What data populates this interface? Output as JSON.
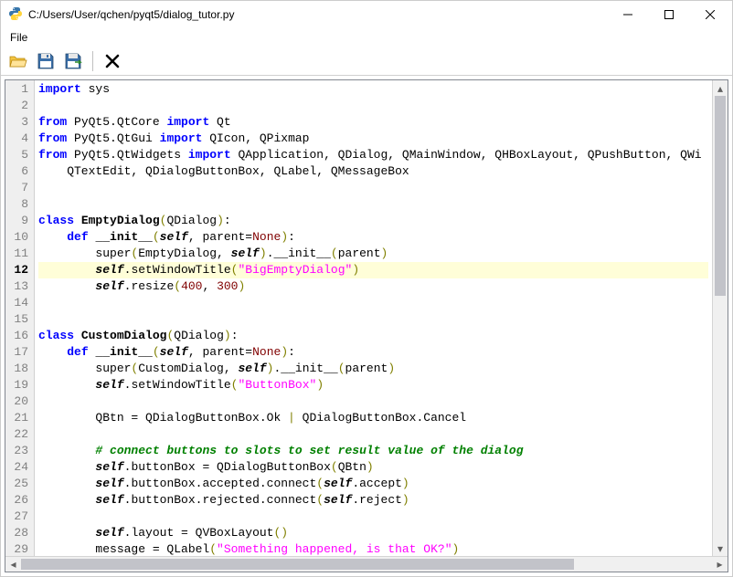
{
  "window": {
    "title": "C:/Users/User/qchen/pyqt5/dialog_tutor.py"
  },
  "menubar": {
    "file": "File"
  },
  "toolbar": {
    "open": "open-folder-icon",
    "save": "save-icon",
    "saveas": "save-as-icon",
    "clear": "clear-icon"
  },
  "editor": {
    "current_line": 12,
    "lines": [
      {
        "n": 1,
        "html": "<span class='kw'>import</span> sys"
      },
      {
        "n": 2,
        "html": ""
      },
      {
        "n": 3,
        "html": "<span class='kw'>from</span> PyQt5.QtCore <span class='kw'>import</span> Qt"
      },
      {
        "n": 4,
        "html": "<span class='kw'>from</span> PyQt5.QtGui <span class='kw'>import</span> QIcon, QPixmap"
      },
      {
        "n": 5,
        "html": "<span class='kw'>from</span> PyQt5.QtWidgets <span class='kw'>import</span> QApplication, QDialog, QMainWindow, QHBoxLayout, QPushButton, QWi"
      },
      {
        "n": 6,
        "html": "    QTextEdit, QDialogButtonBox, QLabel, QMessageBox"
      },
      {
        "n": 7,
        "html": ""
      },
      {
        "n": 8,
        "html": ""
      },
      {
        "n": 9,
        "html": "<span class='kw'>class</span> <span class='cls'>EmptyDialog</span><span class='op'>(</span>QDialog<span class='op'>)</span>:"
      },
      {
        "n": 10,
        "html": "    <span class='kw'>def</span> <span class='fn'>__init__</span><span class='op'>(</span><span class='self'>self</span>, parent=<span class='none'>None</span><span class='op'>)</span>:"
      },
      {
        "n": 11,
        "html": "        super<span class='op'>(</span>EmptyDialog, <span class='self'>self</span><span class='op'>)</span>.__init__<span class='op'>(</span>parent<span class='op'>)</span>"
      },
      {
        "n": 12,
        "html": "        <span class='self'>self</span>.setWindowTitle<span class='op'>(</span><span class='str'>\"BigEmptyDialog\"</span><span class='op'>)</span>"
      },
      {
        "n": 13,
        "html": "        <span class='self'>self</span>.resize<span class='op'>(</span><span class='num'>400</span>, <span class='num'>300</span><span class='op'>)</span>"
      },
      {
        "n": 14,
        "html": ""
      },
      {
        "n": 15,
        "html": ""
      },
      {
        "n": 16,
        "html": "<span class='kw'>class</span> <span class='cls'>CustomDialog</span><span class='op'>(</span>QDialog<span class='op'>)</span>:"
      },
      {
        "n": 17,
        "html": "    <span class='kw'>def</span> <span class='fn'>__init__</span><span class='op'>(</span><span class='self'>self</span>, parent=<span class='none'>None</span><span class='op'>)</span>:"
      },
      {
        "n": 18,
        "html": "        super<span class='op'>(</span>CustomDialog, <span class='self'>self</span><span class='op'>)</span>.__init__<span class='op'>(</span>parent<span class='op'>)</span>"
      },
      {
        "n": 19,
        "html": "        <span class='self'>self</span>.setWindowTitle<span class='op'>(</span><span class='str'>\"ButtonBox\"</span><span class='op'>)</span>"
      },
      {
        "n": 20,
        "html": ""
      },
      {
        "n": 21,
        "html": "        QBtn = QDialogButtonBox.Ok <span class='op'>|</span> QDialogButtonBox.Cancel"
      },
      {
        "n": 22,
        "html": ""
      },
      {
        "n": 23,
        "html": "        <span class='cmt'># connect buttons to slots to set result value of the dialog</span>"
      },
      {
        "n": 24,
        "html": "        <span class='self'>self</span>.buttonBox = QDialogButtonBox<span class='op'>(</span>QBtn<span class='op'>)</span>"
      },
      {
        "n": 25,
        "html": "        <span class='self'>self</span>.buttonBox.accepted.connect<span class='op'>(</span><span class='self'>self</span>.accept<span class='op'>)</span>"
      },
      {
        "n": 26,
        "html": "        <span class='self'>self</span>.buttonBox.rejected.connect<span class='op'>(</span><span class='self'>self</span>.reject<span class='op'>)</span>"
      },
      {
        "n": 27,
        "html": ""
      },
      {
        "n": 28,
        "html": "        <span class='self'>self</span>.layout = QVBoxLayout<span class='op'>()</span>"
      },
      {
        "n": 29,
        "html": "        message = QLabel<span class='op'>(</span><span class='str'>\"Something happened, is that OK?\"</span><span class='op'>)</span>"
      }
    ]
  }
}
